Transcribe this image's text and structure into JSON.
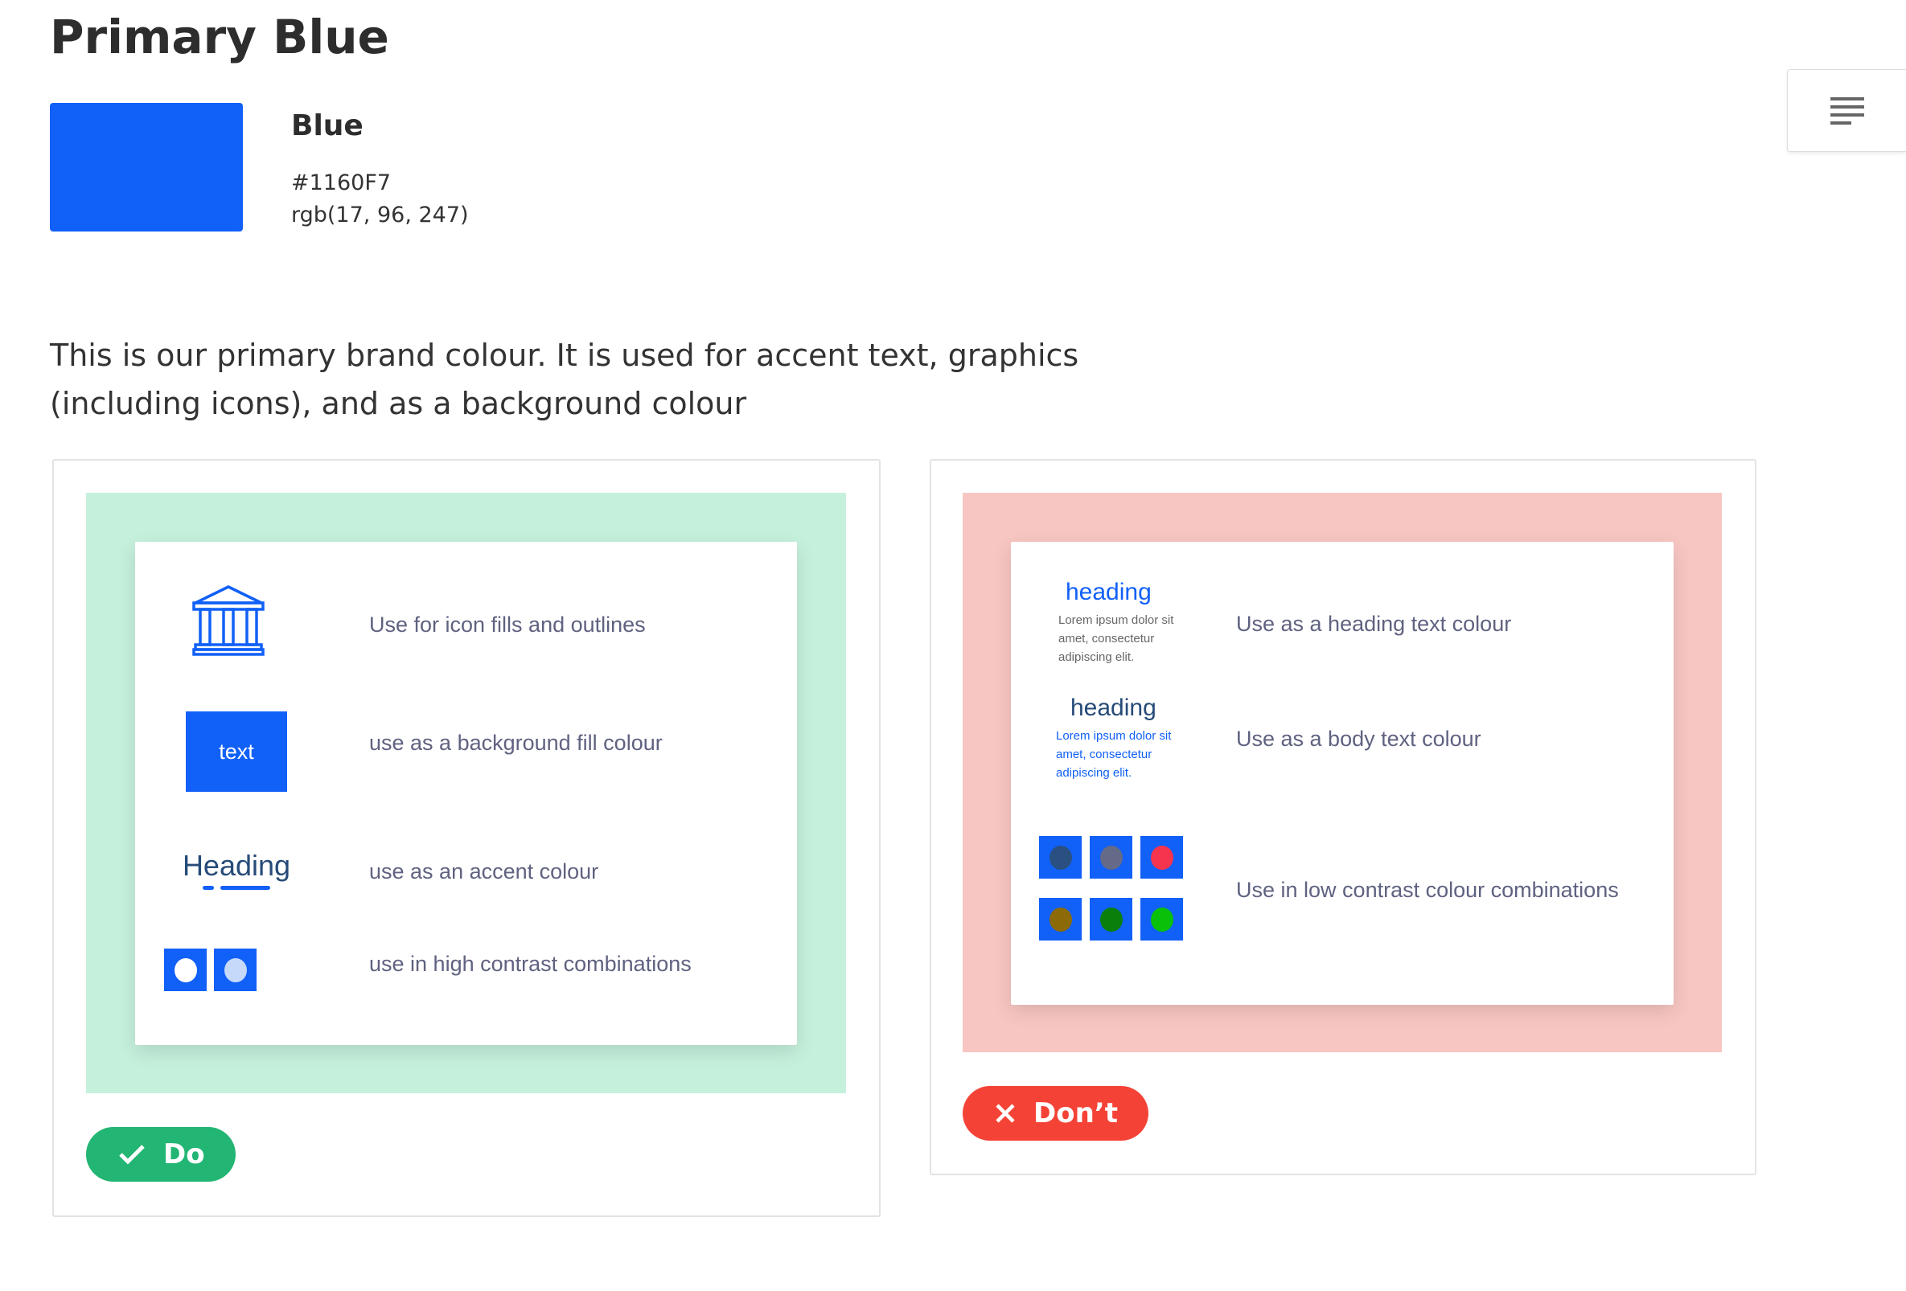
{
  "page": {
    "title": "Primary Blue",
    "description": "This is our primary brand colour. It is used for accent text, graphics (including icons), and as a background colour"
  },
  "color": {
    "name": "Blue",
    "hex": "#1160F7",
    "rgb": "rgb(17, 96, 247)"
  },
  "menu": {
    "icon": "menu-lines-icon"
  },
  "do_card": {
    "button_label": "Do",
    "button_color": "#22B573",
    "bg_color": "#C5F0DC",
    "rows": [
      {
        "icon": "bank-icon",
        "text": "Use for icon fills and outlines"
      },
      {
        "sample": "text",
        "text": "use as a background fill colour"
      },
      {
        "sample": "Heading",
        "text": "use as an accent colour"
      },
      {
        "text": "use in high contrast combinations",
        "dot_colors": [
          "#FFFFFF",
          "#C6D9FB"
        ]
      }
    ]
  },
  "dont_card": {
    "button_label": "Don’t",
    "button_color": "#F44336",
    "bg_color": "#F8C6C2",
    "rows": [
      {
        "heading": "heading",
        "lorem": "Lorem ipsum dolor sit amet, consectetur adipiscing elit.",
        "text": "Use as a heading text colour"
      },
      {
        "heading": "heading",
        "lorem": "Lorem ipsum dolor sit amet, consectetur adipiscing elit.",
        "text": "Use as a body text colour"
      },
      {
        "text": "Use in low contrast colour combinations",
        "dot_colors": [
          "#2A5082",
          "#646A88",
          "#F7344E",
          "#8C6A08",
          "#0A7F0A",
          "#09C109"
        ]
      }
    ]
  }
}
